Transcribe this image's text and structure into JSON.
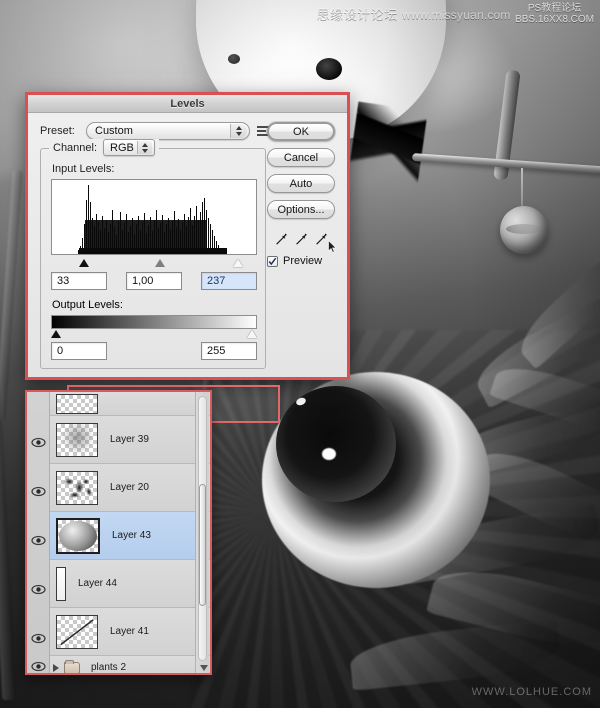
{
  "watermarks": {
    "top_cn": "思缘设计论坛",
    "top_url": "www.missyuan.com",
    "top_stack_line1": "PS教程论坛",
    "top_stack_line2": "BBS.16XX8.COM",
    "bottom": "WWW.LOLHUE.COM"
  },
  "dialog": {
    "title": "Levels",
    "preset": {
      "label": "Preset:",
      "value": "Custom",
      "menu_icon": "preset-menu-icon"
    },
    "channel": {
      "label": "Channel:",
      "value": "RGB"
    },
    "input_levels": {
      "label": "Input Levels:",
      "shadow": "33",
      "midtone": "1,00",
      "highlight": "237"
    },
    "output_levels": {
      "label": "Output Levels:",
      "black": "0",
      "white": "255"
    },
    "buttons": {
      "ok": "OK",
      "cancel": "Cancel",
      "auto": "Auto",
      "options": "Options..."
    },
    "eyedroppers": [
      "eyedropper-black-point-icon",
      "eyedropper-gray-point-icon",
      "eyedropper-white-point-icon"
    ],
    "preview": {
      "label": "Preview",
      "checked": true
    },
    "highlight_color": "#d94f52"
  },
  "layers_panel": {
    "rows": [
      {
        "name": "",
        "visible": true,
        "selected": false,
        "kind": "clipped-top",
        "thumb": "checker"
      },
      {
        "name": "Layer 39",
        "visible": true,
        "selected": false,
        "kind": "layer",
        "thumb": "faint-speckle"
      },
      {
        "name": "Layer 20",
        "visible": true,
        "selected": false,
        "kind": "layer",
        "thumb": "black-splatter"
      },
      {
        "name": "Layer 43",
        "visible": true,
        "selected": true,
        "kind": "layer",
        "thumb": "gray-sphere"
      },
      {
        "name": "Layer 44",
        "visible": true,
        "selected": false,
        "kind": "layer",
        "thumb": "thin-vertical-strip"
      },
      {
        "name": "Layer 41",
        "visible": true,
        "selected": false,
        "kind": "layer",
        "thumb": "diagonal-line"
      },
      {
        "name": "plants 2",
        "visible": true,
        "selected": false,
        "kind": "group",
        "thumb": "folder"
      }
    ],
    "selection_color": "#b5cdee",
    "border_color": "#d9595c"
  }
}
